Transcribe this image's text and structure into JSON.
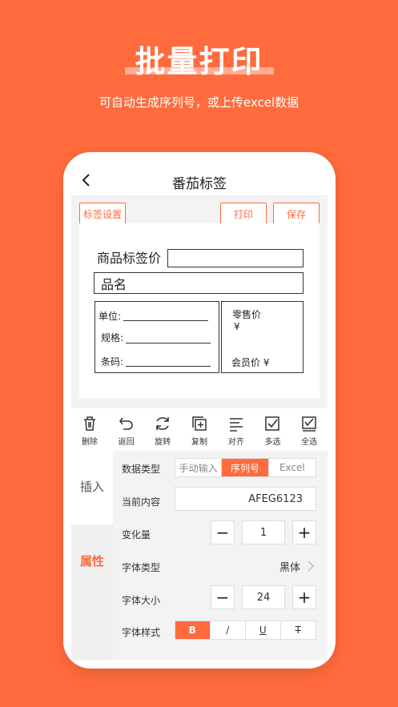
{
  "hero": {
    "title": "批量打印",
    "subtitle": "可自动生成序列号，或上传excel数据"
  },
  "navbar": {
    "title": "番茄标签",
    "back_icon": "chevron-left-icon"
  },
  "actions": {
    "label_settings": "标签设置",
    "print": "打印",
    "save": "保存"
  },
  "label": {
    "price_title": "商品标签价",
    "product_name": "品名",
    "unit": "单位:",
    "spec": "规格:",
    "barcode": "条码:",
    "retail_price": "零售价",
    "currency": "¥",
    "member_price": "会员价 ¥"
  },
  "toolbar": [
    {
      "label": "删除",
      "icon": "trash-icon"
    },
    {
      "label": "返回",
      "icon": "undo-icon"
    },
    {
      "label": "旋转",
      "icon": "rotate-icon"
    },
    {
      "label": "复制",
      "icon": "copy-icon"
    },
    {
      "label": "对齐",
      "icon": "align-icon"
    },
    {
      "label": "多选",
      "icon": "checkbox-icon"
    },
    {
      "label": "全选",
      "icon": "select-all-icon"
    }
  ],
  "side_tabs": {
    "insert": "插入",
    "properties": "属性"
  },
  "properties": {
    "data_type_label": "数据类型",
    "data_type_options": [
      "手动输入",
      "序列号",
      "Excel"
    ],
    "data_type_selected": "序列号",
    "current_content_label": "当前内容",
    "current_content_value": "AFEG6123",
    "increment_label": "变化量",
    "increment_value": "1",
    "font_type_label": "字体类型",
    "font_type_value": "黑体",
    "font_size_label": "字体大小",
    "font_size_value": "24",
    "font_style_label": "字体样式",
    "font_style_options": [
      "B",
      "/",
      "U",
      "T"
    ],
    "font_style_selected": "B"
  },
  "colors": {
    "accent": "#FF6B3D",
    "background": "#FF6B3D"
  }
}
